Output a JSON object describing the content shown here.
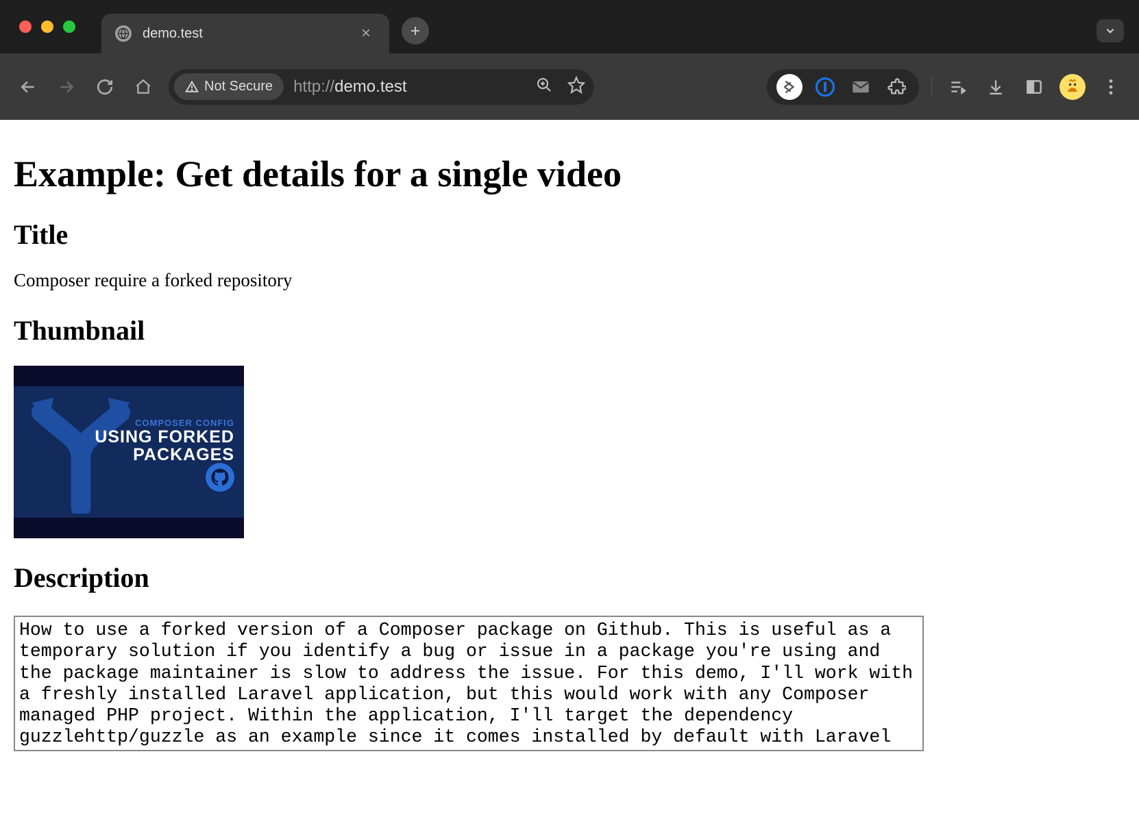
{
  "browser": {
    "tab_title": "demo.test",
    "security_label": "Not Secure",
    "url_scheme": "http://",
    "url_host": "demo.test"
  },
  "page": {
    "heading": "Example: Get details for a single video",
    "sections": {
      "title_heading": "Title",
      "title_value": "Composer require a forked repository",
      "thumbnail_heading": "Thumbnail",
      "thumbnail": {
        "eyebrow": "COMPOSER CONFIG",
        "line1": "USING FORKED",
        "line2": "PACKAGES"
      },
      "description_heading": "Description",
      "description_text": "How to use a forked version of a Composer package on Github. This is useful as a temporary solution if you identify a bug or issue in a package you're using and the package maintainer is slow to address the issue. For this demo, I'll work with a freshly installed Laravel application, but this would work with any Composer managed PHP project. Within the application, I'll target the dependency guzzlehttp/guzzle as an example since it comes installed by default with Laravel applications."
    }
  }
}
